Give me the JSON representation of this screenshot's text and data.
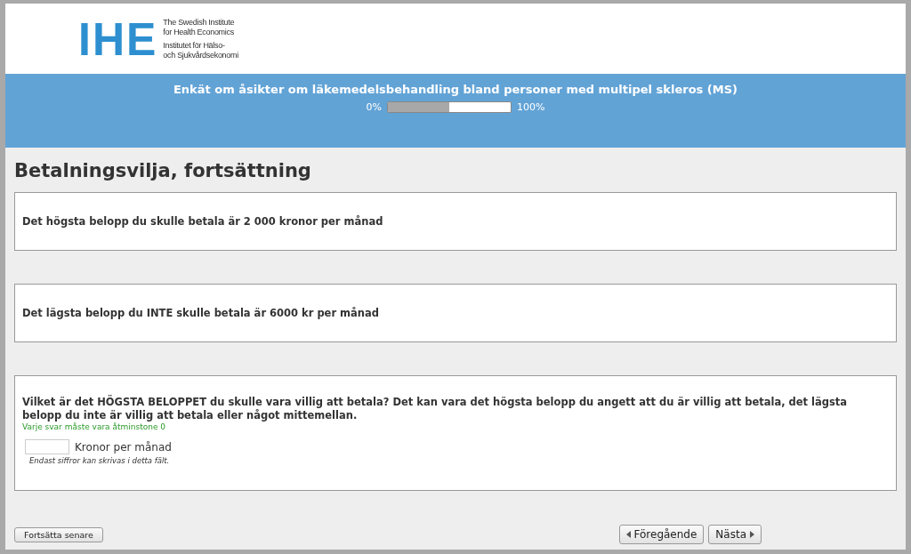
{
  "logo": {
    "mark": "IHE",
    "lines": [
      "The Swedish Institute",
      "for Health Economics",
      "Institutet för Hälso-",
      "och Sjukvårdsekonomi"
    ]
  },
  "survey": {
    "title": "Enkät om åsikter om läkemedelsbehandling bland personer med multipel skleros (MS)",
    "progress_start": "0%",
    "progress_end": "100%",
    "level": 0.5
  },
  "page_title": "Betalningsvilja, fortsättning",
  "questions": [
    {
      "kind": "text",
      "text": "Det högsta belopp du skulle betala är 2 000 kronor per månad"
    },
    {
      "kind": "text",
      "text": "Det lägsta belopp du INTE skulle betala är 6000 kr per månad"
    },
    {
      "kind": "input",
      "text": "Vilket är det HÖGSTA BELOPPET du skulle vara villig att betala? Det kan vara det högsta belopp du angett att du är villig att betala, det lägsta belopp du inte är villig att betala eller något mittemellan.",
      "tip": "Varje svar måste vara åtminstone 0",
      "unit": "Kronor per månad",
      "hint": "Endast siffror kan skrivas i detta fält."
    }
  ],
  "buttons": {
    "later": "Fortsätta senare",
    "prev": "Föregående",
    "next": "Nästa"
  }
}
